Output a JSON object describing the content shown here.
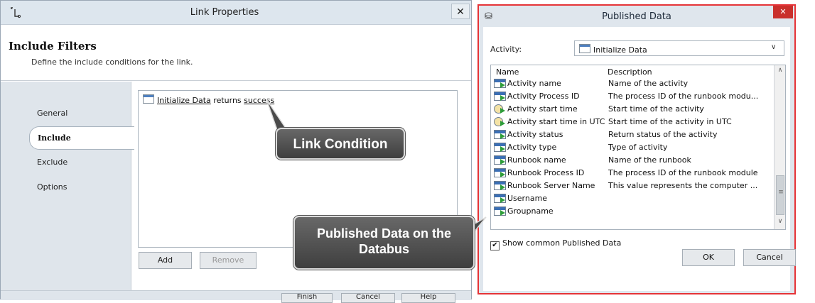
{
  "link_properties": {
    "title": "Link Properties",
    "close_glyph": "✕",
    "heading": "Include Filters",
    "subtitle": "Define the include conditions for the link.",
    "nav": [
      "General",
      "Include",
      "Exclude",
      "Options"
    ],
    "selected_nav": "Include",
    "condition": {
      "activity": "Initialize Data",
      "verb": "returns",
      "value": "success"
    },
    "buttons": {
      "add": "Add",
      "remove": "Remove"
    },
    "bottom_buttons": [
      "Finish",
      "Cancel",
      "Help"
    ]
  },
  "published_data": {
    "title": "Published Data",
    "close_glyph": "✕",
    "activity_label": "Activity:",
    "activity_value": "Initialize Data",
    "columns": {
      "name": "Name",
      "description": "Description"
    },
    "rows": [
      {
        "name": "Activity name",
        "description": "Name of the activity",
        "icon": "data-icon"
      },
      {
        "name": "Activity Process ID",
        "description": "The process ID of the runbook modu...",
        "icon": "data-icon"
      },
      {
        "name": "Activity start time",
        "description": "Start time of the activity",
        "icon": "clock-icon"
      },
      {
        "name": "Activity start time in UTC",
        "description": "Start time of the activity in UTC",
        "icon": "clock-icon"
      },
      {
        "name": "Activity status",
        "description": "Return status of the activity",
        "icon": "data-icon"
      },
      {
        "name": "Activity type",
        "description": "Type of activity",
        "icon": "data-icon"
      },
      {
        "name": "Runbook name",
        "description": "Name of the runbook",
        "icon": "data-icon"
      },
      {
        "name": "Runbook Process ID",
        "description": "The process ID of the runbook module",
        "icon": "data-icon"
      },
      {
        "name": "Runbook Server Name",
        "description": "This value represents the computer ...",
        "icon": "data-icon"
      },
      {
        "name": "Username",
        "description": "",
        "icon": "data-icon"
      },
      {
        "name": "Groupname",
        "description": "",
        "icon": "data-icon"
      }
    ],
    "show_common_label": "Show common Published Data",
    "show_common_checked": true,
    "buttons": {
      "ok": "OK",
      "cancel": "Cancel"
    }
  },
  "callouts": {
    "link_condition": "Link Condition",
    "published_data_line1": "Published Data on the",
    "published_data_line2": "Databus"
  },
  "colors": {
    "highlight_border": "#e53337",
    "callout_bg": "#4d4d4d"
  }
}
